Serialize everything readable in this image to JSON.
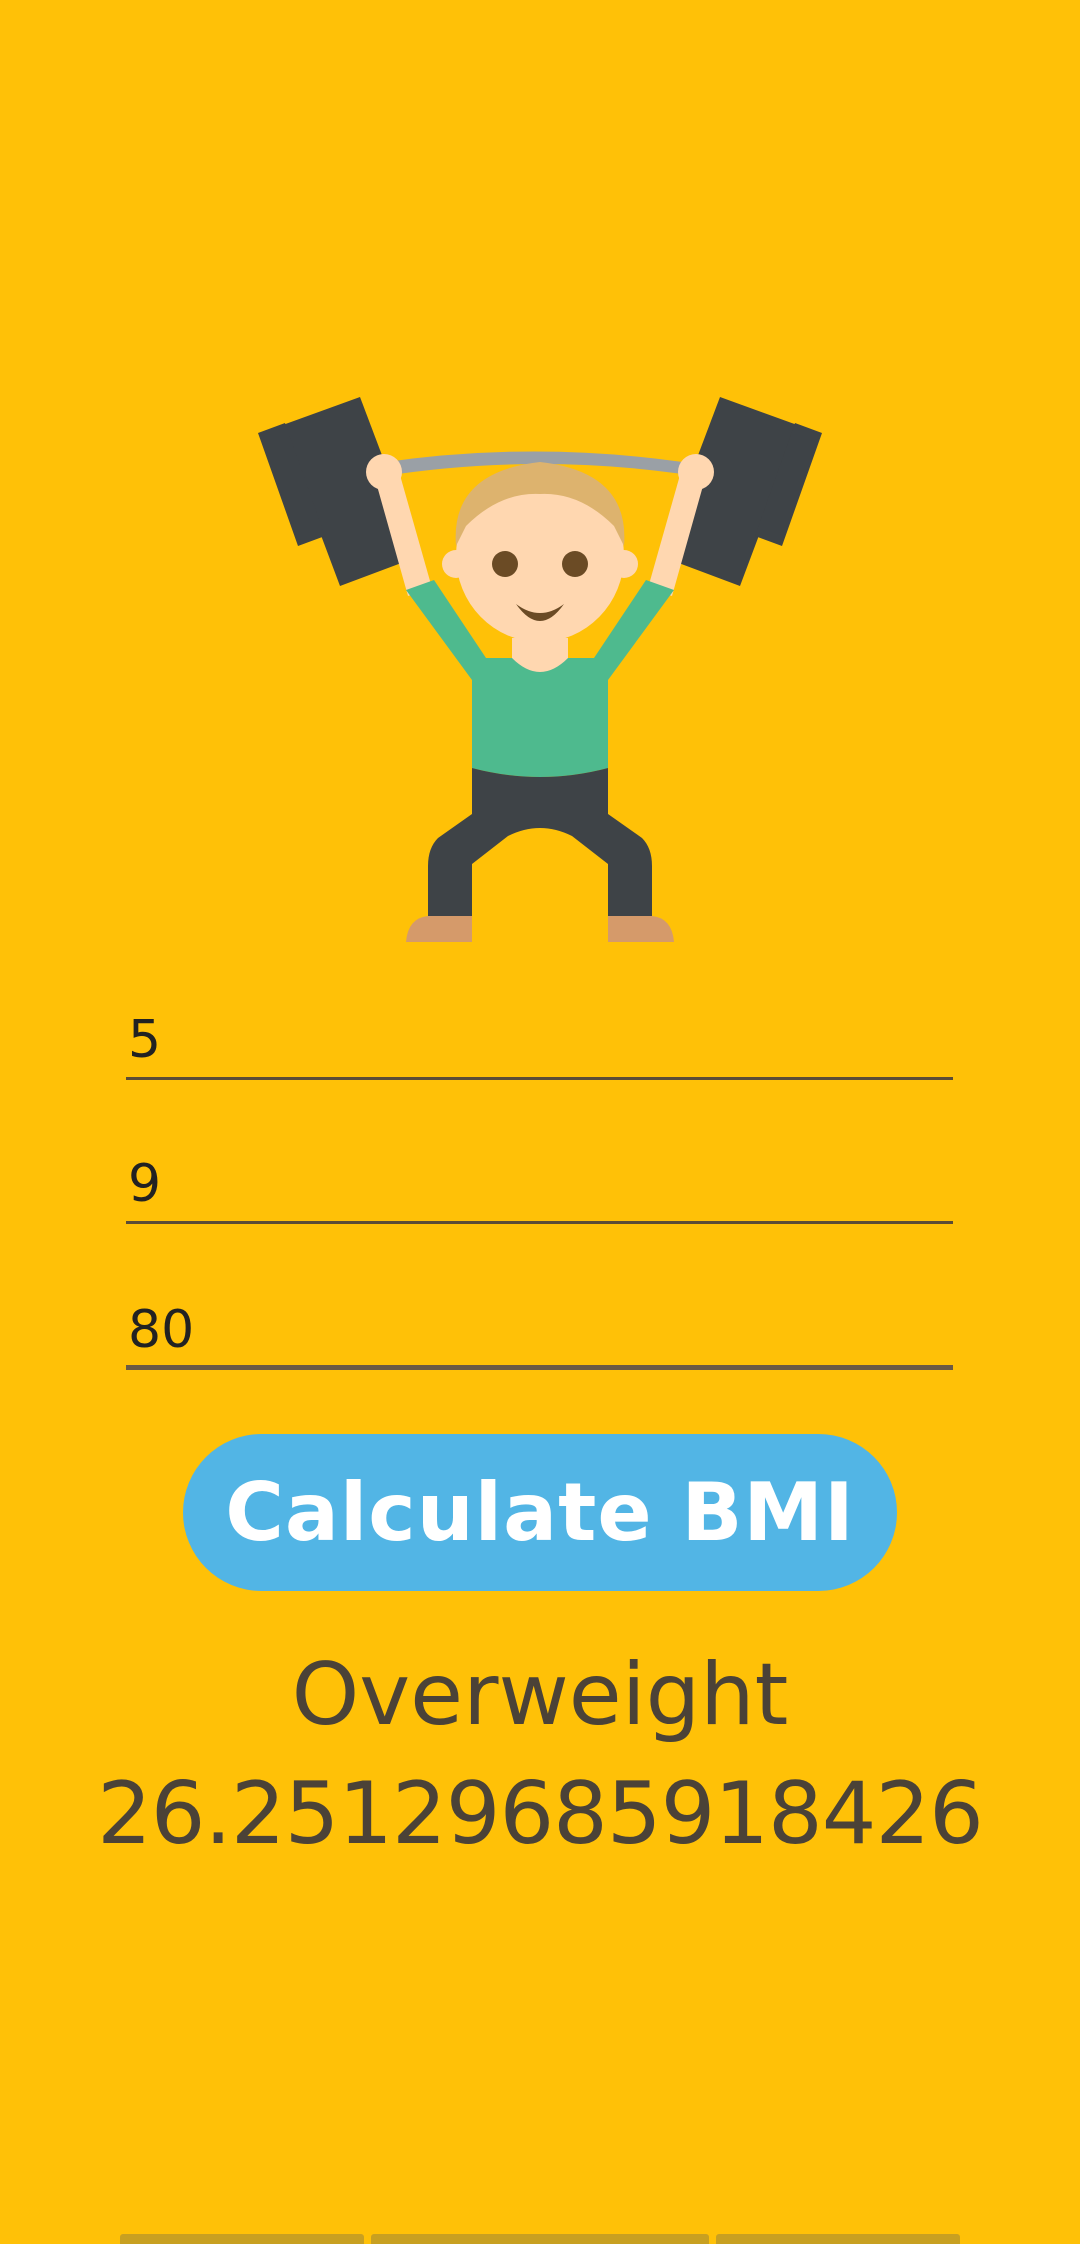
{
  "illustration": {
    "icon": "weightlifter-icon",
    "colors": {
      "background": "#FFC107",
      "weights": "#3E4347",
      "bar": "#9AA0A6",
      "skin": "#FFD7B0",
      "hair": "#DDB36E",
      "shirt": "#4EBA8E",
      "pants": "#3E4347",
      "shoes": "#D59A6A"
    }
  },
  "form": {
    "feet": "5",
    "inches": "9",
    "weight": "80"
  },
  "button": {
    "label": "Calculate BMI",
    "color": "#52B5E5"
  },
  "result": {
    "category": "Overweight",
    "bmi": "26.25129685918426"
  }
}
